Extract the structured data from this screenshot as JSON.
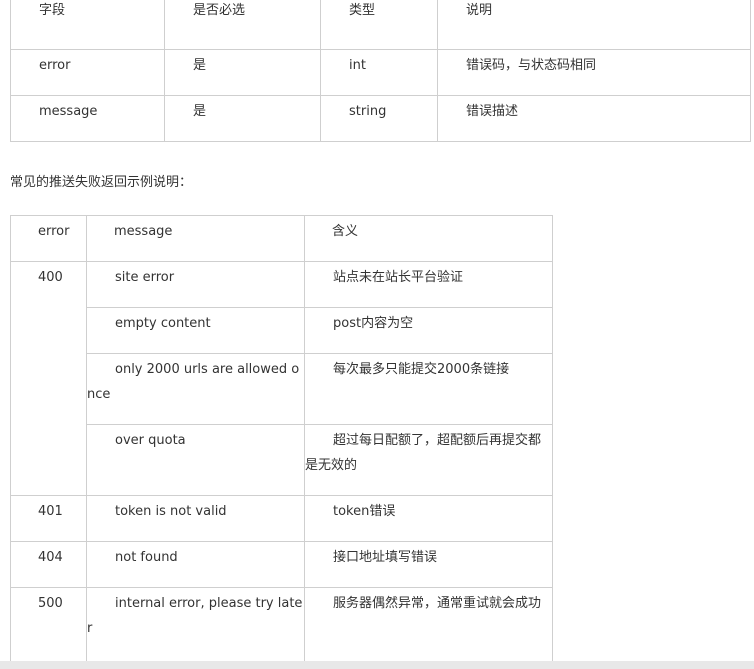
{
  "fields_table": {
    "headers": [
      "字段",
      "是否必选",
      "类型",
      "说明"
    ],
    "rows": [
      [
        "error",
        "是",
        "int",
        "错误码，与状态码相同"
      ],
      [
        "message",
        "是",
        "string",
        "错误描述"
      ]
    ]
  },
  "intro_text": "常见的推送失败返回示例说明：",
  "errors_table": {
    "headers": [
      "error",
      "message",
      "含义"
    ],
    "code_400": "400",
    "rows_400": [
      {
        "message": "site error",
        "meaning": "站点未在站长平台验证"
      },
      {
        "message": "empty content",
        "meaning": "post内容为空"
      },
      {
        "message": "only 2000 urls are allowed once",
        "meaning": "每次最多只能提交2000条链接"
      },
      {
        "message": "over quota",
        "meaning": "超过每日配额了，超配额后再提交都是无效的"
      }
    ],
    "rows_other": [
      {
        "code": "401",
        "message": "token is not valid",
        "meaning": "token错误"
      },
      {
        "code": "404",
        "message": "not found",
        "meaning": "接口地址填写错误"
      },
      {
        "code": "500",
        "message": "internal error, please try later",
        "meaning": "服务器偶然异常，通常重试就会成功"
      }
    ]
  }
}
